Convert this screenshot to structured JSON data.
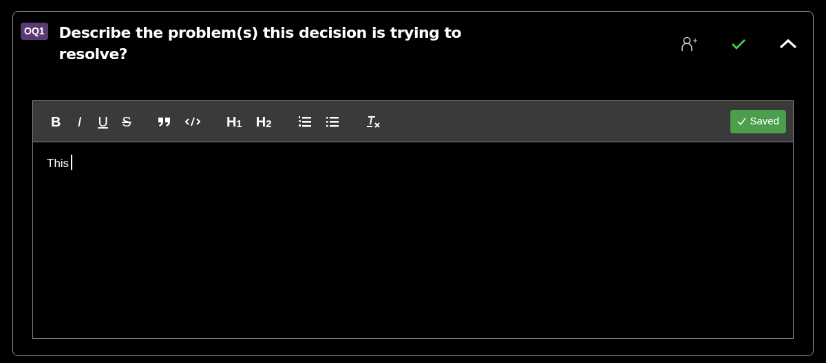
{
  "question": {
    "badge": "OQ1",
    "title": "Describe the problem(s) this decision is trying to resolve?",
    "completed": true,
    "expanded": true
  },
  "toolbar": [
    {
      "kind": "bold",
      "label": "B"
    },
    {
      "kind": "italic",
      "label": "I"
    },
    {
      "kind": "underline",
      "label": "U"
    },
    {
      "kind": "strike",
      "label": "S"
    },
    {
      "kind": "quote"
    },
    {
      "kind": "code"
    },
    {
      "kind": "heading",
      "label": "H$_{1}$"
    },
    {
      "kind": "heading",
      "label": "H$_{2}$"
    },
    {
      "kind": "ordered-list"
    },
    {
      "kind": "bullet-list"
    },
    {
      "kind": "clear-format"
    }
  ],
  "save_status": {
    "label": "Saved",
    "saved": true
  },
  "editor": {
    "value": "This",
    "focused": true
  }
}
